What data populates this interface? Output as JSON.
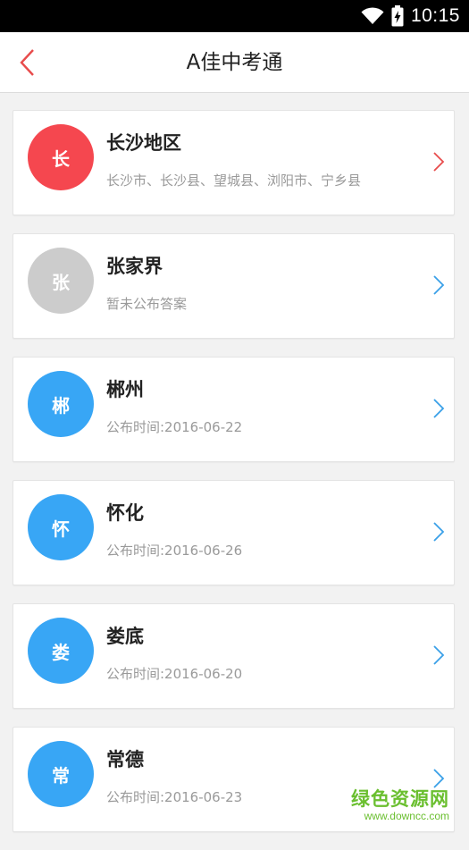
{
  "status_bar": {
    "time": "10:15",
    "icons": [
      "wifi-icon",
      "battery-charging-icon"
    ]
  },
  "header": {
    "title": "A佳中考通",
    "back_icon": "chevron-left-icon",
    "accent_color": "#e84c4c"
  },
  "regions": [
    {
      "avatar_char": "长",
      "title": "长沙地区",
      "subtitle": "长沙市、长沙县、望城县、浏阳市、宁乡县",
      "avatar_color": "#f5474f",
      "chevron_color": "#e84c4c"
    },
    {
      "avatar_char": "张",
      "title": "张家界",
      "subtitle": "暂未公布答案",
      "avatar_color": "#cccccc",
      "chevron_color": "#3aa0e8"
    },
    {
      "avatar_char": "郴",
      "title": "郴州",
      "subtitle": "公布时间:2016-06-22",
      "avatar_color": "#38a6f5",
      "chevron_color": "#3aa0e8"
    },
    {
      "avatar_char": "怀",
      "title": "怀化",
      "subtitle": "公布时间:2016-06-26",
      "avatar_color": "#38a6f5",
      "chevron_color": "#3aa0e8"
    },
    {
      "avatar_char": "娄",
      "title": "娄底",
      "subtitle": "公布时间:2016-06-20",
      "avatar_color": "#38a6f5",
      "chevron_color": "#3aa0e8"
    },
    {
      "avatar_char": "常",
      "title": "常德",
      "subtitle": "公布时间:2016-06-23",
      "avatar_color": "#38a6f5",
      "chevron_color": "#3aa0e8"
    }
  ],
  "watermark": {
    "main": "绿色资源网",
    "sub": "www.downcc.com"
  }
}
